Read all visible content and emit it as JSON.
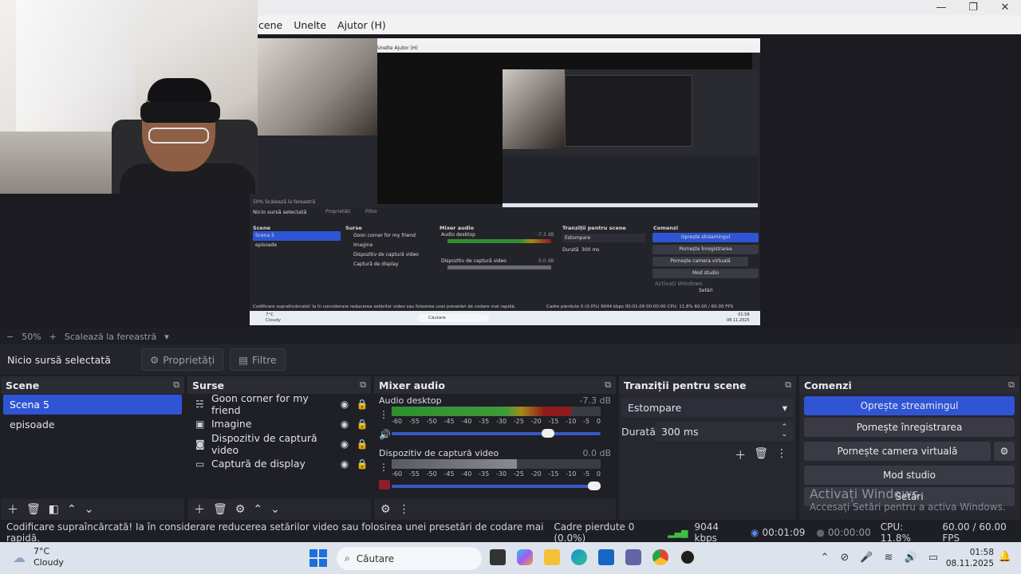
{
  "menu": {
    "items": [
      "cene",
      "Unelte",
      "Ajutor (H)"
    ]
  },
  "preview": {
    "nested_menu": "Unelte   Ajutor (H)",
    "mini": {
      "scenes_title": "Scene",
      "sources_title": "Surse",
      "mixer_title": "Mixer audio",
      "transitions_title": "Tranziții pentru scene",
      "commands_title": "Comenzi",
      "no_source": "Nicio sursă selectată",
      "properties": "Proprietăți",
      "filters": "Filtre",
      "zoom": "50%   Scalează la fereastră",
      "scenes": [
        "Scena 5",
        "episoade"
      ],
      "sources": [
        "Goon corner for my friend",
        "Imagine",
        "Dispozitiv de captură video",
        "Captură de display"
      ],
      "mixer_ch1": "Audio desktop",
      "mixer_ch1_db": "-7.3 dB",
      "mixer_ch2": "Dispozitiv de captură video",
      "mixer_ch2_db": "0.0 dB",
      "transition": "Estompare",
      "duration_label": "Durată",
      "duration_value": "300 ms",
      "cmd_stream": "Oprește streamingul",
      "cmd_record": "Pornește înregistrarea",
      "cmd_vcam": "Pornește camera virtuală",
      "cmd_studio": "Mod studio",
      "cmd_settings": "Setări",
      "activate": "Activați Windows",
      "status": "Codificare supraîncărcată! Ia în considerare reducerea setărilor video sau folosirea unei presetări de codare mai rapidă.",
      "status_right": "Cadre pierdute 0 (0.0%)   9044 kbps   00:01:09   00:00:00   CPU: 11.8%   60.00 / 60.00 FPS",
      "weather_temp": "7°C",
      "weather_desc": "Cloudy",
      "search": "Căutare",
      "time": "01:58",
      "date": "08.11.2025"
    }
  },
  "zoom": {
    "minus": "−",
    "value": "50%",
    "plus": "+",
    "label": "Scalează la fereastră"
  },
  "source_bar": {
    "no_source": "Nicio sursă selectată",
    "properties": "Proprietăți",
    "filters": "Filtre"
  },
  "scenes": {
    "title": "Scene",
    "items": [
      "Scena 5",
      "episoade"
    ]
  },
  "sources": {
    "title": "Surse",
    "items": [
      "Goon corner for my friend",
      "Imagine",
      "Dispozitiv de captură video",
      "Captură de display"
    ]
  },
  "mixer": {
    "title": "Mixer audio",
    "scale": [
      "-60",
      "-55",
      "-50",
      "-45",
      "-40",
      "-35",
      "-30",
      "-25",
      "-20",
      "-15",
      "-10",
      "-5",
      "0"
    ],
    "channels": [
      {
        "name": "Audio desktop",
        "db": "-7.3 dB",
        "level": 0.86,
        "volume": 0.78
      },
      {
        "name": "Dispozitiv de captură video",
        "db": "0.0 dB",
        "level": 0.6,
        "volume": 1.0
      }
    ]
  },
  "transitions": {
    "title": "Tranziții pentru scene",
    "selected": "Estompare",
    "duration_label": "Durată",
    "duration_value": "300 ms"
  },
  "commands": {
    "title": "Comenzi",
    "stream": "Oprește streamingul",
    "record": "Pornește înregistrarea",
    "vcam": "Pornește camera virtuală",
    "studio": "Mod studio",
    "settings": "Setări"
  },
  "activate": {
    "title": "Activați Windows",
    "sub": "Accesați Setări pentru a activa Windows."
  },
  "status": {
    "message": "Codificare supraîncărcată! Ia în considerare reducerea setărilor video sau folosirea unei presetări de codare mai rapidă.",
    "dropped": "Cadre pierdute 0 (0.0%)",
    "bitrate": "9044 kbps",
    "stream_time": "00:01:09",
    "rec_time": "00:00:00",
    "cpu": "CPU: 11.8%",
    "fps": "60.00 / 60.00 FPS"
  },
  "taskbar": {
    "temp": "7°C",
    "weather": "Cloudy",
    "search": "Căutare",
    "time": "01:58",
    "date": "08.11.2025"
  },
  "colors": {
    "accent": "#2f55d4",
    "dock_bg": "#272730",
    "panel_bg": "#1f1f26"
  }
}
